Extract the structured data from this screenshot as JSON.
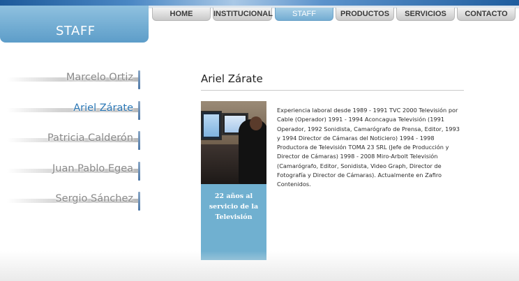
{
  "section_tab": {
    "label": "STAFF"
  },
  "nav": {
    "items": [
      {
        "label": "HOME",
        "active": false
      },
      {
        "label": "INSTITUCIONAL",
        "active": false
      },
      {
        "label": "STAFF",
        "active": true
      },
      {
        "label": "PRODUCTOS",
        "active": false
      },
      {
        "label": "SERVICIOS",
        "active": false
      },
      {
        "label": "CONTACTO",
        "active": false
      }
    ]
  },
  "sidebar": {
    "items": [
      {
        "label": "Marcelo Ortiz",
        "active": false
      },
      {
        "label": "Ariel Zárate",
        "active": true
      },
      {
        "label": "Patricia Calderón",
        "active": false
      },
      {
        "label": "Juan Pablo Egea",
        "active": false
      },
      {
        "label": "Sergio Sánchez",
        "active": false
      }
    ]
  },
  "profile": {
    "name": "Ariel Zárate",
    "caption": "22 años al servicio de la Televisión",
    "bio": "Experiencia laboral desde 1989 - 1991 TVC 2000 Televisión por Cable (Operador) 1991 - 1994 Aconcagua Televisión (1991 Operador, 1992 Sonidista, Camarógrafo de Prensa, Editor, 1993 y 1994 Director de Cámaras del Noticiero) 1994 - 1998 Productora de Televisión TOMA 23 SRL (Jefe de Producción y Director de Cámaras) 1998 - 2008 Miro-Arbolt Televisión (Camarógrafo, Editor, Sonidista, Video Graph, Director de Fotografía y Director de Cámaras). Actualmente en Zafiro Contenidos."
  },
  "colors": {
    "accent": "#70b0d0",
    "active_text": "#2c78b6",
    "brand_bar": "#1d5a9a"
  }
}
